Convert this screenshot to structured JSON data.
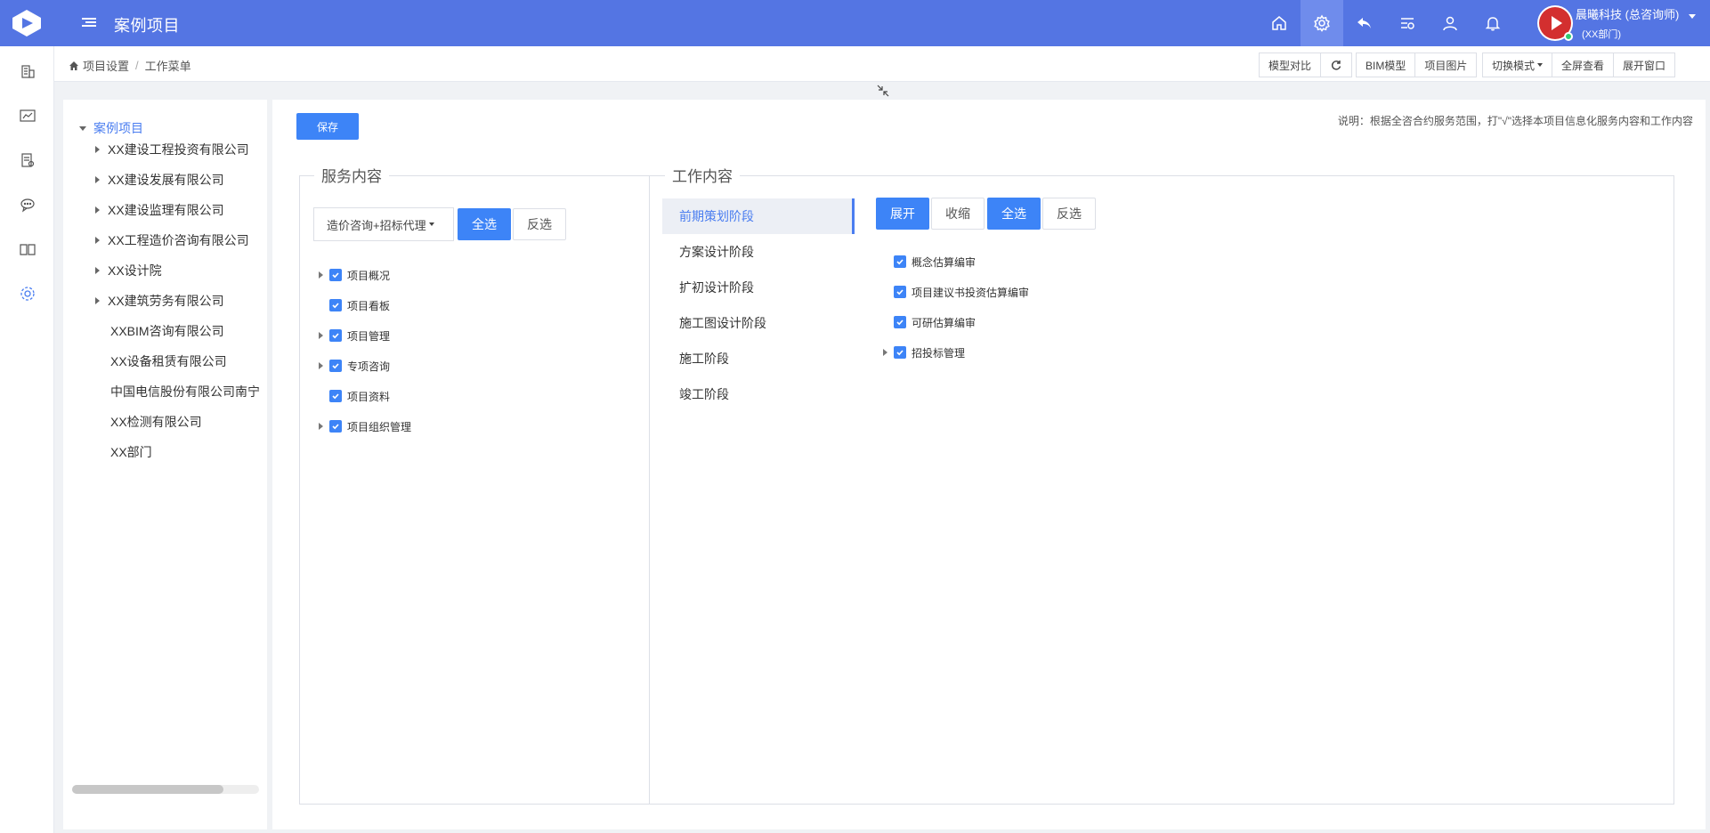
{
  "header": {
    "app_title": "案例项目",
    "user_name": "晨曦科技 (总咨询师)",
    "user_dept": "(XX部门)",
    "icons": [
      "home-icon",
      "settings-icon",
      "back-icon",
      "list-icon",
      "user-icon",
      "bell-icon"
    ]
  },
  "rail": {
    "icons": [
      "building-icon",
      "chart-icon",
      "document-icon",
      "chat-icon",
      "book-icon",
      "gear-icon"
    ]
  },
  "breadcrumb": {
    "items": [
      "项目设置",
      "工作菜单"
    ]
  },
  "toolbar": {
    "model_compare": "模型对比",
    "bim_model": "BIM模型",
    "project_images": "项目图片",
    "switch_mode": "切换模式",
    "fullscreen": "全屏查看",
    "expand_window": "展开窗口"
  },
  "tree": {
    "root": "案例项目",
    "nodes": [
      "XX建设工程投资有限公司",
      "XX建设发展有限公司",
      "XX建设监理有限公司",
      "XX工程造价咨询有限公司",
      "XX设计院",
      "XX建筑劳务有限公司",
      "XXBIM咨询有限公司",
      "XX设备租赁有限公司",
      "中国电信股份有限公司南宁",
      "XX检测有限公司",
      "XX部门"
    ]
  },
  "main": {
    "save_label": "保存",
    "note": "说明：根据全咨合约服务范围，打\"√\"选择本项目信息化服务内容和工作内容",
    "service": {
      "legend": "服务内容",
      "select_value": "造价咨询+招标代理",
      "select_all": "全选",
      "invert": "反选",
      "items": [
        "项目概况",
        "项目看板",
        "项目管理",
        "专项咨询",
        "项目资料",
        "项目组织管理"
      ]
    },
    "work": {
      "legend": "工作内容",
      "stages": [
        "前期策划阶段",
        "方案设计阶段",
        "扩初设计阶段",
        "施工图设计阶段",
        "施工阶段",
        "竣工阶段"
      ],
      "expand": "展开",
      "collapse": "收缩",
      "select_all": "全选",
      "invert": "反选",
      "items": [
        "概念估算编审",
        "项目建议书投资估算编审",
        "可研估算编审",
        "招投标管理"
      ]
    }
  },
  "colors": {
    "header_bg": "#5475e3",
    "primary": "#3d84f7",
    "link": "#4a7df0"
  }
}
